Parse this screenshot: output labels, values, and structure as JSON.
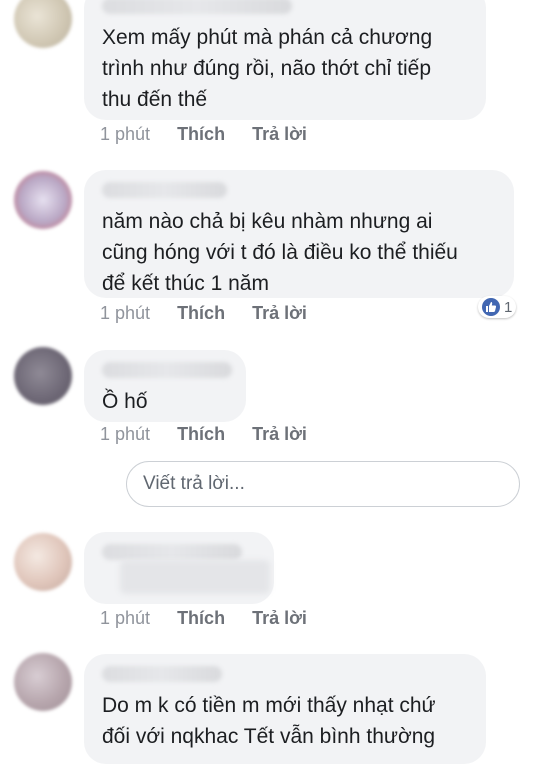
{
  "comments": [
    {
      "text": "Xem mấy phút mà phán cả chương\ntrình như đúng rồi, não thớt chỉ tiếp\nthu đến thế",
      "time": "1 phút",
      "like": "Thích",
      "reply": "Trả lời"
    },
    {
      "text": "năm nào chả bị kêu nhàm nhưng ai\ncũng hóng với t đó là điều ko thể thiếu\nđể kết thúc 1 năm",
      "time": "1 phút",
      "like": "Thích",
      "reply": "Trả lời",
      "reaction_count": "1"
    },
    {
      "text": "Ồ hố",
      "time": "1 phút",
      "like": "Thích",
      "reply": "Trả lời"
    },
    {
      "text": "",
      "time": "1 phút",
      "like": "Thích",
      "reply": "Trả lời"
    },
    {
      "text": "Do m k có tiền m mới thấy nhạt chứ\nđối với nqkhac Tết vẫn bình thường"
    }
  ],
  "reply_input": {
    "placeholder": "Viết trả lời..."
  },
  "colors": {
    "bubble": "#f2f3f5",
    "like_blue": "#4267b2",
    "meta": "#90949c"
  }
}
